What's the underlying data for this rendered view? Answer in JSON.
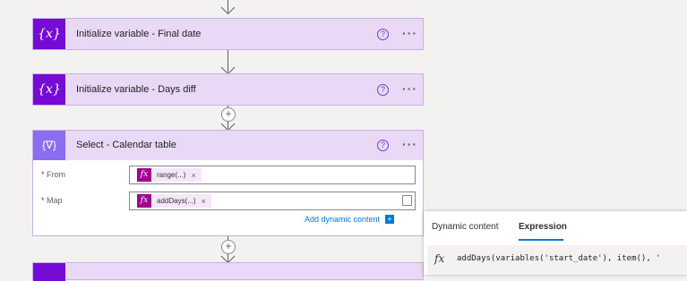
{
  "flow": {
    "cards": [
      {
        "title": "Initialize variable - Final date",
        "icon": "{x}"
      },
      {
        "title": "Initialize variable - Days diff",
        "icon": "{x}"
      }
    ],
    "select_card": {
      "title": "Select - Calendar table",
      "icon": "{∇}",
      "fields": [
        {
          "label": "From",
          "required_mark": "*",
          "token": "range(...)",
          "token_fx": "fx"
        },
        {
          "label": "Map",
          "required_mark": "*",
          "token": "addDays(...)",
          "token_fx": "fx"
        }
      ],
      "add_dynamic_label": "Add dynamic content",
      "add_dynamic_icon": "+"
    },
    "help_glyph": "?",
    "more_glyph": "···",
    "plus_glyph": "+"
  },
  "panel": {
    "tabs": [
      "Dynamic content",
      "Expression"
    ],
    "active_tab": "Expression",
    "fx_glyph": "fx",
    "expression": "addDays(variables('start_date'), item(), '"
  },
  "colors": {
    "variable_icon": "#770bd6",
    "select_icon": "#8c6cf0",
    "card_bg": "#e9d9f6",
    "token_fx": "#a4008f",
    "accent": "#0078d4"
  }
}
